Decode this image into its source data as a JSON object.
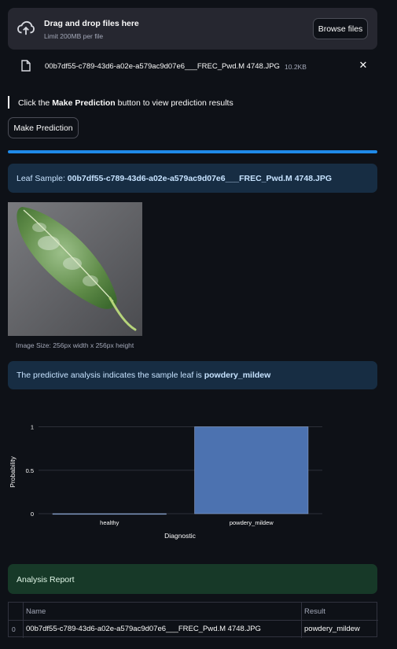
{
  "uploader": {
    "title": "Drag and drop files here",
    "limit": "Limit 200MB per file",
    "browse_label": "Browse files",
    "icon": "cloud-upload-icon"
  },
  "uploaded_file": {
    "name": "00b7df55-c789-43d6-a02e-a579ac9d07e6___FREC_Pwd.M 4748.JPG",
    "size": "10.2KB",
    "close": "✕"
  },
  "instruction": {
    "before": "Click the ",
    "bold": "Make Prediction",
    "after": " button to view prediction results"
  },
  "predict_button": {
    "label": "Make Prediction"
  },
  "progress": {
    "value": 1.0,
    "color": "#1f8ae8"
  },
  "leaf_sample": {
    "prefix": "Leaf Sample: ",
    "filename": "00b7df55-c789-43d6-a02e-a579ac9d07e6___FREC_Pwd.M 4748.JPG",
    "caption": "Image Size: 256px width x 256px height"
  },
  "prediction": {
    "text": "The predictive analysis indicates the sample leaf is ",
    "result": "powdery_mildew"
  },
  "chart_data": {
    "type": "bar",
    "categories": [
      "healthy",
      "powdery_mildew"
    ],
    "values": [
      0.0,
      1.0
    ],
    "xlabel": "Diagnostic",
    "ylabel": "Probability",
    "ylim": [
      0,
      1.05
    ],
    "yticks": [
      0,
      0.5,
      1
    ],
    "ytick_labels": [
      "0",
      "0.5",
      "1"
    ],
    "grid": true,
    "bar_color": "#4c72b0"
  },
  "report": {
    "title": "Analysis Report",
    "columns": [
      "",
      "Name",
      "Result"
    ],
    "rows": [
      [
        "0",
        "00b7df55-c789-43d6-a02e-a579ac9d07e6___FREC_Pwd.M 4748.JPG",
        "powdery_mildew"
      ]
    ]
  }
}
